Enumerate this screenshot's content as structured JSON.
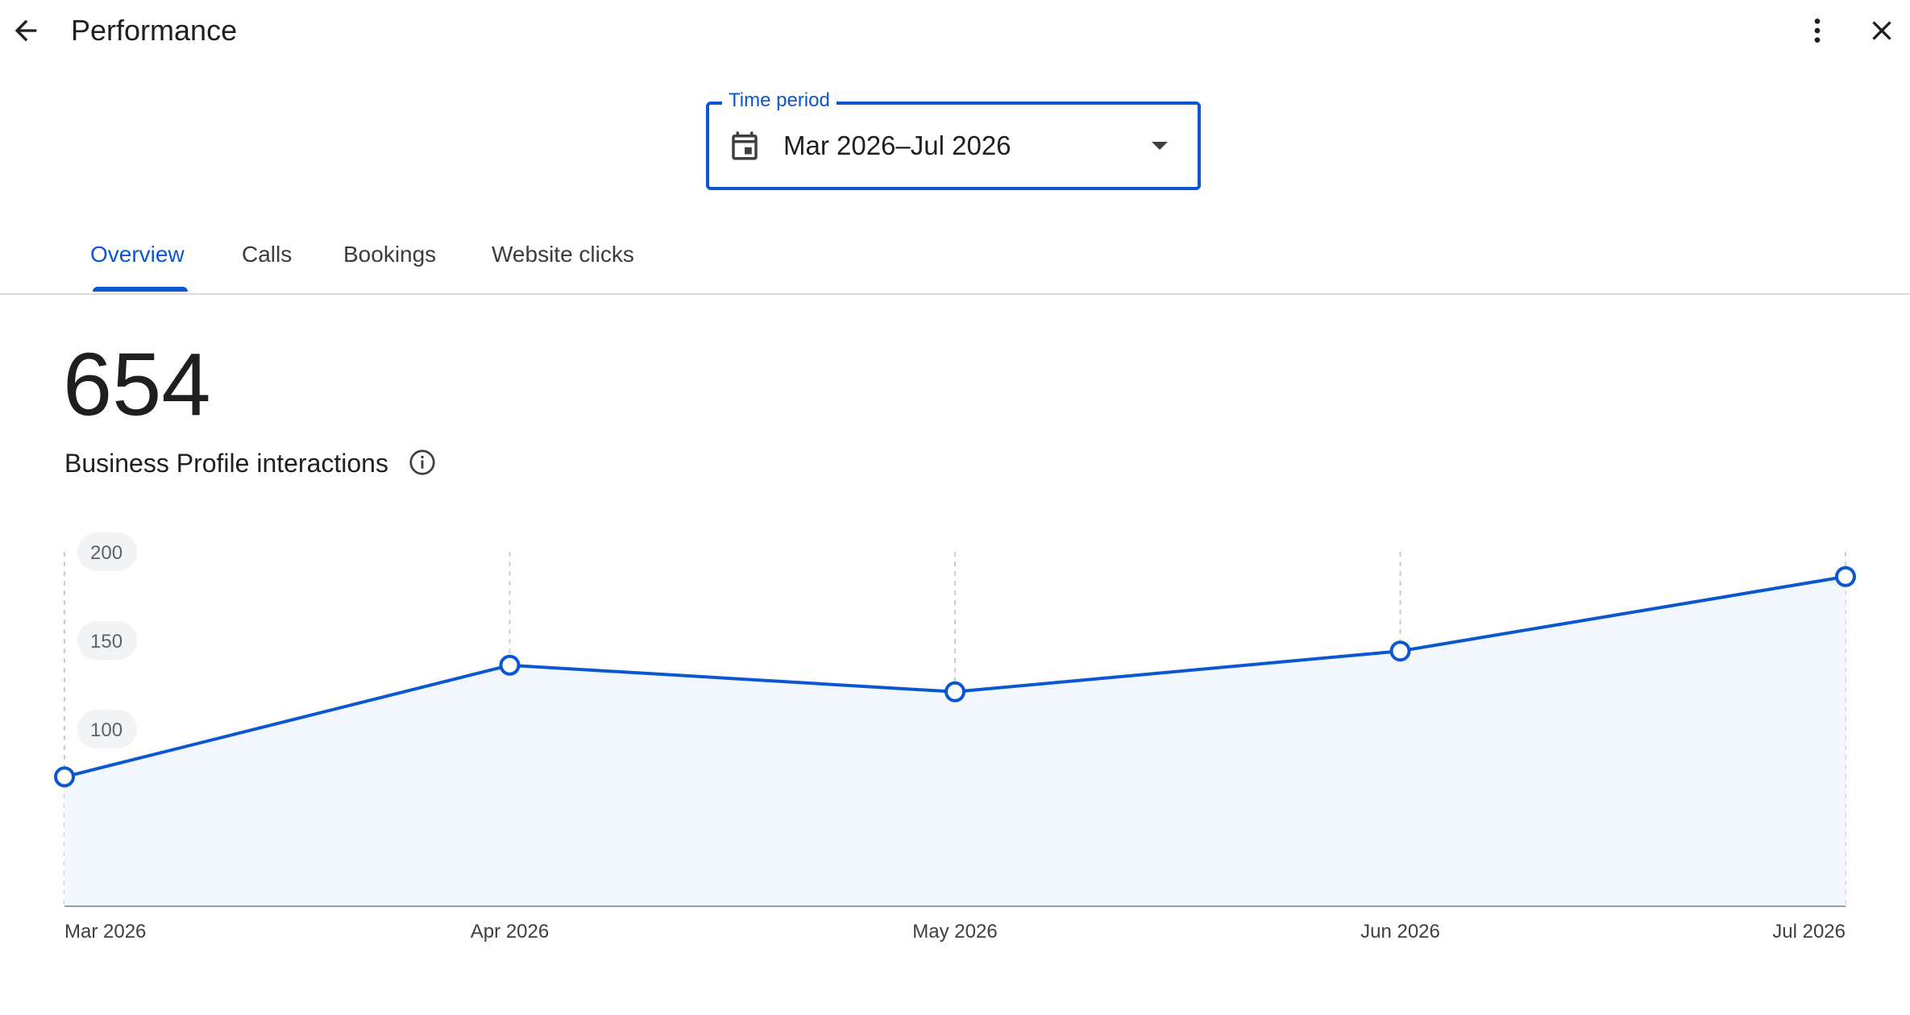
{
  "header": {
    "title": "Performance",
    "back_icon": "arrow-back-icon",
    "more_icon": "more-vert-icon",
    "close_icon": "close-icon"
  },
  "time_period": {
    "label": "Time period",
    "value": "Mar 2026–Jul 2026",
    "icon": "calendar-icon",
    "dropdown_icon": "arrow-drop-down-icon"
  },
  "tabs": [
    {
      "label": "Overview",
      "active": true
    },
    {
      "label": "Calls",
      "active": false
    },
    {
      "label": "Bookings",
      "active": false
    },
    {
      "label": "Website clicks",
      "active": false
    }
  ],
  "summary": {
    "total": "654",
    "label": "Business Profile interactions",
    "info_icon": "info-icon"
  },
  "colors": {
    "accent": "#0b57d0",
    "area_fill": "#f2f7fd",
    "grid": "#c9ccd1",
    "axis": "#9aa0a6"
  },
  "chart_data": {
    "type": "area",
    "categories": [
      "Mar 2026",
      "Apr 2026",
      "May 2026",
      "Jun 2026",
      "Jul 2026"
    ],
    "series": [
      {
        "values": [
          73,
          136,
          121,
          144,
          186
        ]
      }
    ],
    "yticks": [
      50,
      100,
      150,
      200
    ],
    "ylim": [
      0,
      200
    ],
    "grid": "vertical dashed",
    "legend": "none"
  }
}
